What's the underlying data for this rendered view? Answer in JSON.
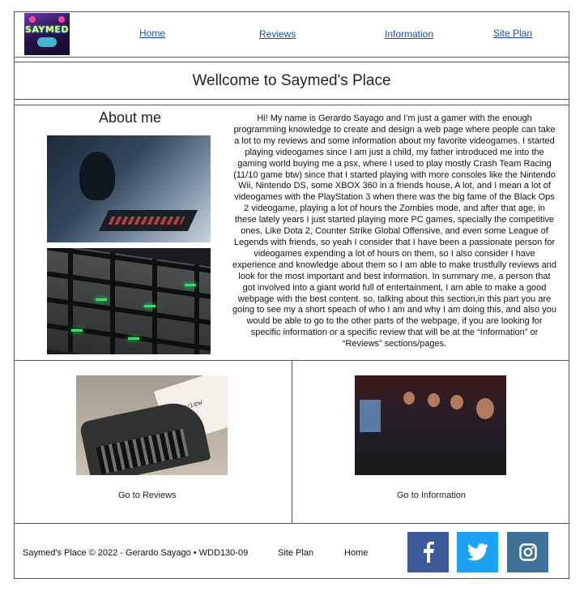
{
  "header": {
    "logo_text": "SAYMED",
    "nav": [
      {
        "label": "Home"
      },
      {
        "label": "Reviews"
      },
      {
        "label": "Information"
      },
      {
        "label": "Site Plan"
      }
    ],
    "link_color": "#1a4fb0"
  },
  "welcome": {
    "title": "Wellcome to Saymed's Place"
  },
  "about": {
    "title": "About me",
    "text": "Hi! My name is Gerardo Sayago and I'm just a gamer with the enough programming knowledge to create and design a web page where people can take a lot to my reviews and some information about my favorite videogames. I started playing videogames since I am just a child, my father introduced me into the gaming world buying me a psx, where I used to play mostly Crash Team Racing (11/10 game btw) since that I started playing with more consoles like the Nintendo Wii, Nintendo DS, some XBOX 360 in a friends house, A lot, and I mean a lot of videogames with the PlayStation 3 when there was the big fame of the Black Ops 2 videogame, playing a lot of hours the Zombies mode, and after that age, in these lately years I just started playing more PC games, specially the competitive ones, Like Dota 2, Counter Strike Global Offensive, and even some League of Legends with friends, so yeah I consider that I have been a passionate person for videogames expending a lot of hours on them, so I also consider I have experience and knowledge about them so I am able to make trustfully reviews and look for the most important and best information. In summary me, a person that got involved into a giant world full of entertainment, I am able to make a good webpage with the best content. so, talking about this section,in this part you are going to see my a short speach of who I am and why I am doing this, and also you would be able to go to the other parts of the webpage, if you are looking for specific information or a specific review that will be at the “Information” or “Reviews” sections/pages.",
    "images": [
      "gamer-with-headset-photo",
      "green-backlit-keyboard-photo"
    ]
  },
  "cards": [
    {
      "label": "Go to Reviews",
      "image": "typewriter-photo",
      "paper_text": "Review"
    },
    {
      "label": "Go to Information",
      "image": "gamers-at-pcs-photo"
    }
  ],
  "footer": {
    "copyright": "Saymed's Place © 2022 - Gerardo Sayago • WDD130-09",
    "links": [
      {
        "label": "Site Plan"
      },
      {
        "label": "Home"
      }
    ],
    "social": [
      {
        "name": "facebook-icon",
        "color": "#3b5998"
      },
      {
        "name": "twitter-icon",
        "color": "#1da1f2"
      },
      {
        "name": "instagram-icon",
        "color": "#3f729b"
      }
    ]
  }
}
